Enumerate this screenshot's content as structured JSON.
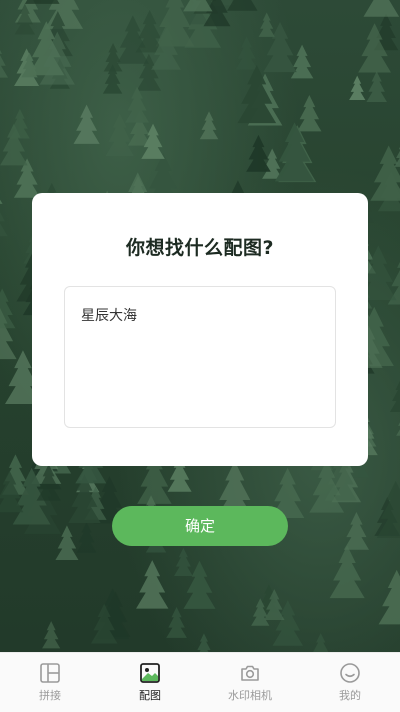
{
  "dialog": {
    "title": "你想找什么配图?",
    "input_value": "星辰大海"
  },
  "confirm_button": {
    "label": "确定",
    "color": "#5cb85c"
  },
  "tabbar": {
    "items": [
      {
        "label": "拼接",
        "icon": "layout-grid-icon",
        "active": false
      },
      {
        "label": "配图",
        "icon": "image-icon",
        "active": true
      },
      {
        "label": "水印相机",
        "icon": "camera-icon",
        "active": false
      },
      {
        "label": "我的",
        "icon": "smile-face-icon",
        "active": false
      }
    ]
  },
  "colors": {
    "accent": "#5cb85c",
    "forest": "#2d4a37"
  }
}
